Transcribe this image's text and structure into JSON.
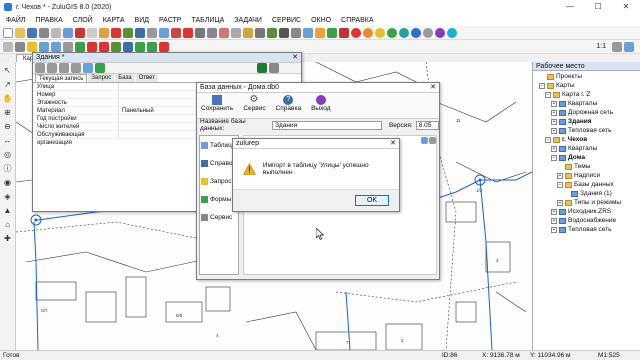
{
  "window": {
    "title": "г. Чехов * - ZuluGIS 8.0 (2020)",
    "controls": [
      "—",
      "☐",
      "✕"
    ]
  },
  "menu": [
    "ФАЙЛ",
    "ПРАВКА",
    "СЛОЙ",
    "КАРТА",
    "ВИД",
    "РАСТР",
    "ТАБЛИЦА",
    "ЗАДАЧИ",
    "СЕРВИС",
    "ОКНО",
    "СПРАВКА"
  ],
  "map_tab": "Карта",
  "zoom_label": "1:1",
  "colors": {
    "accent": "#0078d7",
    "road": "#1e5fd0",
    "building": "#222222",
    "warning": "#f2b705"
  },
  "record_window": {
    "title": "Здания *",
    "tabs": [
      "Текущая запись",
      "Запрос",
      "База",
      "Ответ"
    ],
    "fields": [
      {
        "label": "Улица",
        "value": ""
      },
      {
        "label": "Номер",
        "value": ""
      },
      {
        "label": "Этажность",
        "value": ""
      },
      {
        "label": "Материал",
        "value": "Панельный"
      },
      {
        "label": "Год постройки",
        "value": ""
      },
      {
        "label": "Число жителей",
        "value": ""
      },
      {
        "label": "Обслуживающая организация",
        "value": ""
      }
    ]
  },
  "db_window": {
    "title": "База данных - Дома.db0",
    "toolbar": [
      "Сохранить",
      "Сервис",
      "Справка",
      "Выход"
    ],
    "name_label": "Название базы данных:",
    "name_value": "Здания",
    "version_label": "Версия:",
    "version_value": "8.05",
    "side_items": [
      "Таблица",
      "Справо",
      "Запрос",
      "Формы",
      "Сервис"
    ]
  },
  "message_box": {
    "title": "zulurep",
    "text": "Импорт в таблицу 'Улицы' успешно выполнен",
    "ok": "OK"
  },
  "panel": {
    "title": "Рабочее место",
    "items": [
      {
        "label": "Проекты",
        "depth": 1,
        "toggle": "",
        "icon": "folder"
      },
      {
        "label": "Карты",
        "depth": 1,
        "toggle": "−",
        "icon": "folder"
      },
      {
        "label": "Карта г. Z",
        "depth": 2,
        "toggle": "−",
        "icon": "map"
      },
      {
        "label": "Кварталы",
        "depth": 3,
        "toggle": "+",
        "icon": "layer"
      },
      {
        "label": "Дорожная сеть",
        "depth": 3,
        "toggle": "+",
        "icon": "layer"
      },
      {
        "label": "Здания",
        "depth": 3,
        "toggle": "+",
        "icon": "layer",
        "bold": true
      },
      {
        "label": "Тепловая сеть",
        "depth": 3,
        "toggle": "+",
        "icon": "layer"
      },
      {
        "label": "г. Чехов",
        "depth": 2,
        "toggle": "−",
        "icon": "map",
        "bold": true
      },
      {
        "label": "Кварталы",
        "depth": 3,
        "toggle": "+",
        "icon": "layer"
      },
      {
        "label": "Дома",
        "depth": 3,
        "toggle": "−",
        "icon": "layer",
        "bold": true
      },
      {
        "label": "Темы",
        "depth": 4,
        "toggle": "",
        "icon": "folder"
      },
      {
        "label": "Надписи",
        "depth": 4,
        "toggle": "+",
        "icon": "folder"
      },
      {
        "label": "Базы данных",
        "depth": 4,
        "toggle": "−",
        "icon": "folder"
      },
      {
        "label": "Здания (1)",
        "depth": 5,
        "toggle": "",
        "icon": "layer"
      },
      {
        "label": "Типы и режимы",
        "depth": 4,
        "toggle": "+",
        "icon": "folder"
      },
      {
        "label": "Исходник.ZRS",
        "depth": 3,
        "toggle": "+",
        "icon": "layer"
      },
      {
        "label": "Водоснабжение",
        "depth": 3,
        "toggle": "+",
        "icon": "layer"
      },
      {
        "label": "Тепловая сеть",
        "depth": 3,
        "toggle": "+",
        "icon": "layer"
      }
    ]
  },
  "status": {
    "left": "Готов",
    "id": "ID:86",
    "x": "X: 9136.78 м",
    "y": "Y: 11034.96 м",
    "scale": "M1:525"
  }
}
